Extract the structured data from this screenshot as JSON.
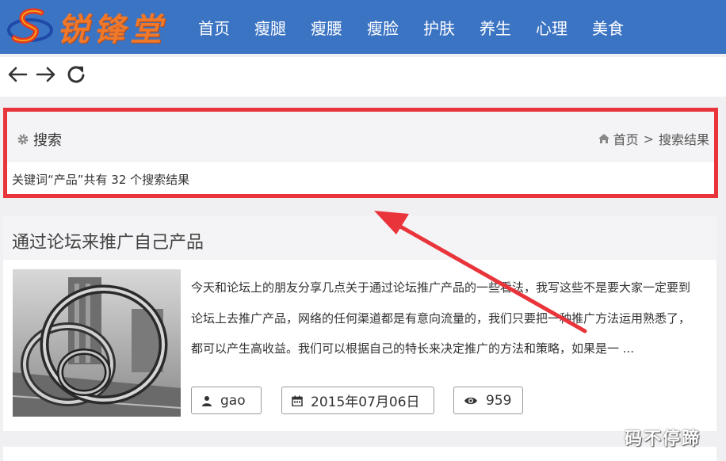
{
  "header": {
    "logo_text": "锐锋堂",
    "nav": [
      "首页",
      "瘦腿",
      "瘦腰",
      "瘦脸",
      "护肤",
      "养生",
      "心理",
      "美食"
    ]
  },
  "toolbar": {
    "back_icon": "arrow-left-icon",
    "forward_icon": "arrow-right-icon",
    "reload_icon": "reload-icon"
  },
  "search": {
    "title": "搜索",
    "breadcrumb_home": "首页",
    "breadcrumb_sep": ">",
    "breadcrumb_current": "搜索结果",
    "result_text": "关键词“产品”共有 32 个搜索结果",
    "highlight_color": "#e8343a"
  },
  "article": {
    "title": "通过论坛来推广自己产品",
    "excerpt": "今天和论坛上的朋友分享几点关于通过论坛推广产品的一些看法，我写这些不是要大家一定要到论坛上去推广产品，网络的任何渠道都是有意向流量的，我们只要把一种推广方法运用熟悉了，都可以产生高收益。我们可以根据自己的特长来决定推广的方法和策略，如果是一 ...",
    "author": "gao",
    "date": "2015年07月06日",
    "views": "959"
  },
  "watermark": "码不停蹄",
  "colors": {
    "nav_bg": "#3c74c4",
    "logo_orange": "#f0782a",
    "annotation_red": "#e8343a"
  }
}
